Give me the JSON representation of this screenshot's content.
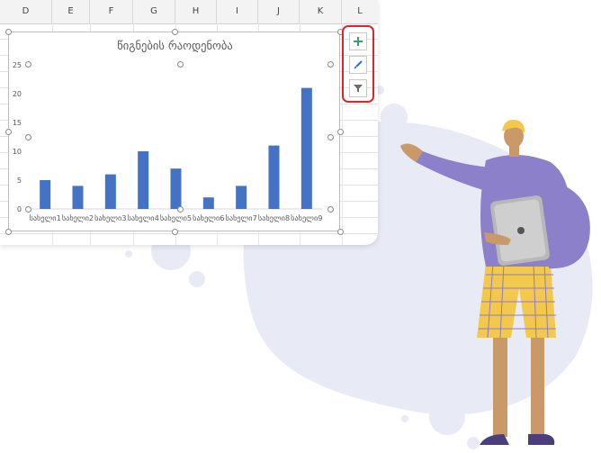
{
  "spreadsheet": {
    "columns": [
      "D",
      "E",
      "F",
      "G",
      "H",
      "I",
      "J",
      "K",
      "L"
    ]
  },
  "chart_tools": {
    "add_element_icon": "plus-icon",
    "style_icon": "paintbrush-icon",
    "filter_icon": "funnel-icon"
  },
  "colors": {
    "bar": "#4472c4",
    "selection_highlight": "#e0242a",
    "plus_icon": "#3a9e6f"
  },
  "chart_data": {
    "type": "bar",
    "title": "წიგნების რაოდენობა",
    "categories": [
      "სახელი1",
      "სახელი2",
      "სახელი3",
      "სახელი4",
      "სახელი5",
      "სახელი6",
      "სახელი7",
      "სახელი8",
      "სახელი9"
    ],
    "values": [
      5,
      4,
      6,
      10,
      7,
      2,
      4,
      11,
      21
    ],
    "yticks": [
      0,
      5,
      10,
      15,
      20,
      25
    ],
    "ylim": [
      0,
      25
    ],
    "xlabel": "",
    "ylabel": "",
    "grid": false,
    "legend": "none"
  }
}
